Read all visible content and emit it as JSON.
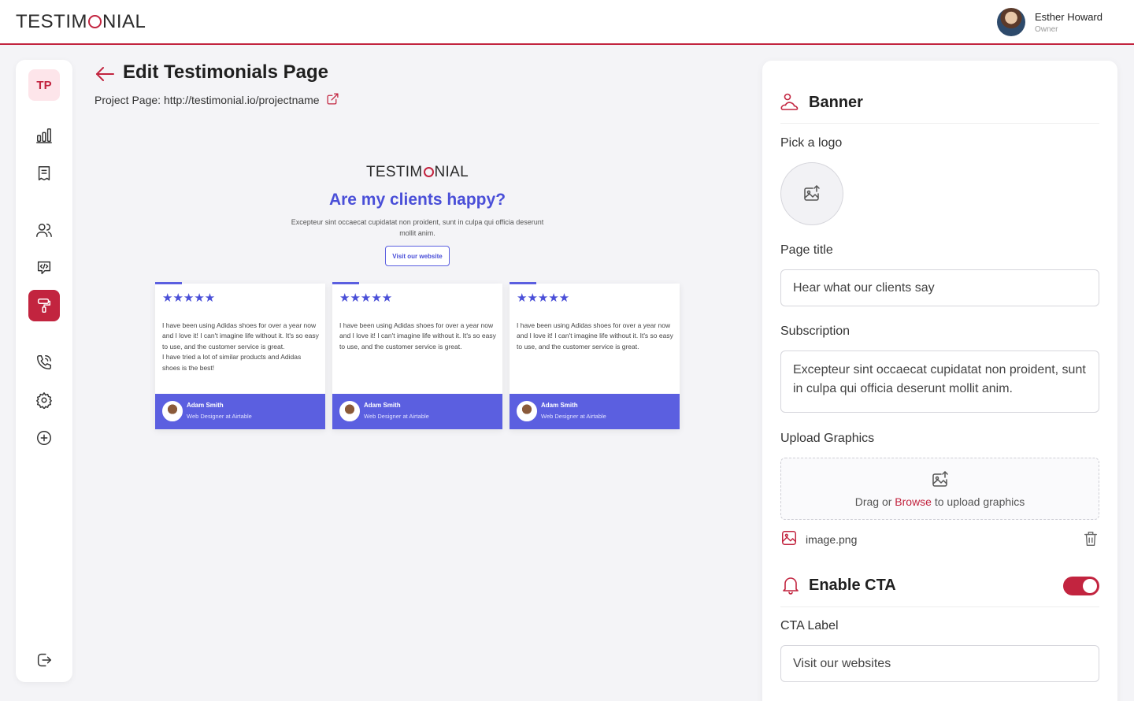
{
  "header": {
    "brand_pre": "TESTIM",
    "brand_post": "NIAL",
    "user_name": "Esther Howard",
    "user_role": "Owner"
  },
  "sidebar": {
    "badge": "TP",
    "items": [
      {
        "name": "chart",
        "icon": "bar-chart-icon"
      },
      {
        "name": "testimonials",
        "icon": "document-icon"
      },
      {
        "name": "users",
        "icon": "users-icon"
      },
      {
        "name": "embed",
        "icon": "code-message-icon"
      },
      {
        "name": "design",
        "icon": "paint-roller-icon",
        "active": true
      },
      {
        "name": "calls",
        "icon": "phone-icon"
      },
      {
        "name": "settings",
        "icon": "gear-icon"
      },
      {
        "name": "add",
        "icon": "plus-circle-icon"
      },
      {
        "name": "logout",
        "icon": "logout-icon"
      }
    ]
  },
  "main": {
    "title": "Edit Testimonials Page",
    "project_label": "Project Page: http://testimonial.io/projectname"
  },
  "preview": {
    "brand_pre": "TESTIM",
    "brand_post": "NIAL",
    "title": "Are my clients happy?",
    "subtitle": "Excepteur sint occaecat cupidatat non proident, sunt in culpa qui officia deserunt mollit anim.",
    "cta": "Visit our website",
    "cards": [
      {
        "stars": "★★★★★",
        "text": "I have been using Adidas shoes for over a year now and I love it! I can't imagine life without it. It's so easy to use, and the customer service is great.\nI have tried a lot of similar products and Adidas shoes is the best!",
        "name": "Adam Smith",
        "role": "Web Designer at Airtable"
      },
      {
        "stars": "★★★★★",
        "text": "I have been using Adidas shoes for over a year now and I love it! I can't imagine life without it. It's so easy to use, and the customer service is great.",
        "name": "Adam Smith",
        "role": "Web Designer at Airtable"
      },
      {
        "stars": "★★★★★",
        "text": "I have been using Adidas shoes for over a year now and I love it! I can't imagine life without it. It's so easy to use, and the customer service is great.",
        "name": "Adam Smith",
        "role": "Web Designer at Airtable"
      }
    ]
  },
  "panel": {
    "banner_title": "Banner",
    "logo_label": "Pick a logo",
    "page_title_label": "Page title",
    "page_title_value": "Hear what our clients say",
    "subscription_label": "Subscription",
    "subscription_value": "Excepteur sint occaecat cupidatat non proident, sunt in culpa qui officia deserunt mollit anim.",
    "upload_label": "Upload Graphics",
    "upload_pre": "Drag or ",
    "upload_browse": "Browse",
    "upload_post": " to upload graphics",
    "file_name": "image.png",
    "cta_title": "Enable CTA",
    "cta_enabled": true,
    "cta_label": "CTA Label",
    "cta_value": "Visit our websites"
  },
  "colors": {
    "accent": "#c2243f",
    "preview_blue": "#5b5fe0"
  }
}
